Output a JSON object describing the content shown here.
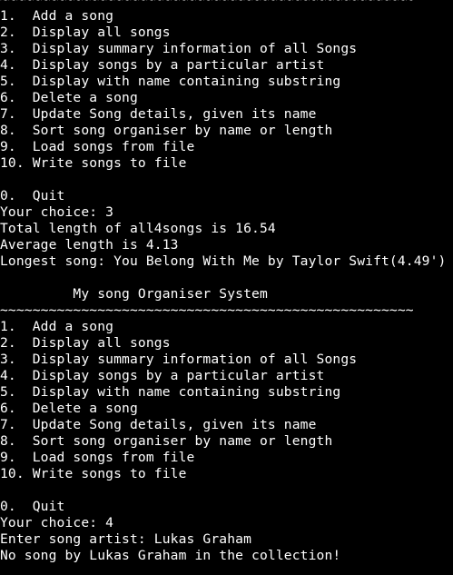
{
  "terminal": {
    "block1": {
      "separator": "~~~~~~~~~~~~~~~~~~~~~~~~~~~~~~~~~~~~~~~~~~~~~~~~~~~",
      "menu": [
        "1.  Add a song",
        "2.  Display all songs",
        "3.  Display summary information of all Songs",
        "4.  Display songs by a particular artist",
        "5.  Display with name containing substring",
        "6.  Delete a song",
        "7.  Update Song details, given its name",
        "8.  Sort song organiser by name or length",
        "9.  Load songs from file",
        "10. Write songs to file"
      ],
      "quit": "0.  Quit",
      "choice": "Your choice: 3",
      "output": [
        "Total length of all4songs is 16.54",
        "Average length is 4.13",
        "Longest song: You Belong With Me by Taylor Swift(4.49')"
      ]
    },
    "block2": {
      "title": "         My song Organiser System",
      "separator": "~~~~~~~~~~~~~~~~~~~~~~~~~~~~~~~~~~~~~~~~~~~~~~~~~~~",
      "menu": [
        "1.  Add a song",
        "2.  Display all songs",
        "3.  Display summary information of all Songs",
        "4.  Display songs by a particular artist",
        "5.  Display with name containing substring",
        "6.  Delete a song",
        "7.  Update Song details, given its name",
        "8.  Sort song organiser by name or length",
        "9.  Load songs from file",
        "10. Write songs to file"
      ],
      "quit": "0.  Quit",
      "choice": "Your choice: 4",
      "prompt": "Enter song artist: Lukas Graham",
      "output": "No song by Lukas Graham in the collection!"
    }
  }
}
